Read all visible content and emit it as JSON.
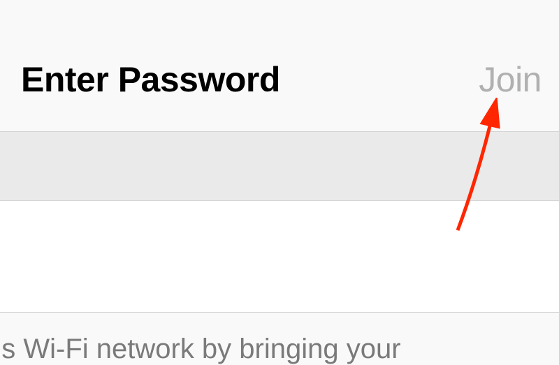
{
  "header": {
    "title": "Enter Password",
    "join_label": "Join"
  },
  "hint": {
    "text": "this Wi-Fi network by bringing your"
  },
  "annotation": {
    "arrow_color": "#ff2600"
  }
}
